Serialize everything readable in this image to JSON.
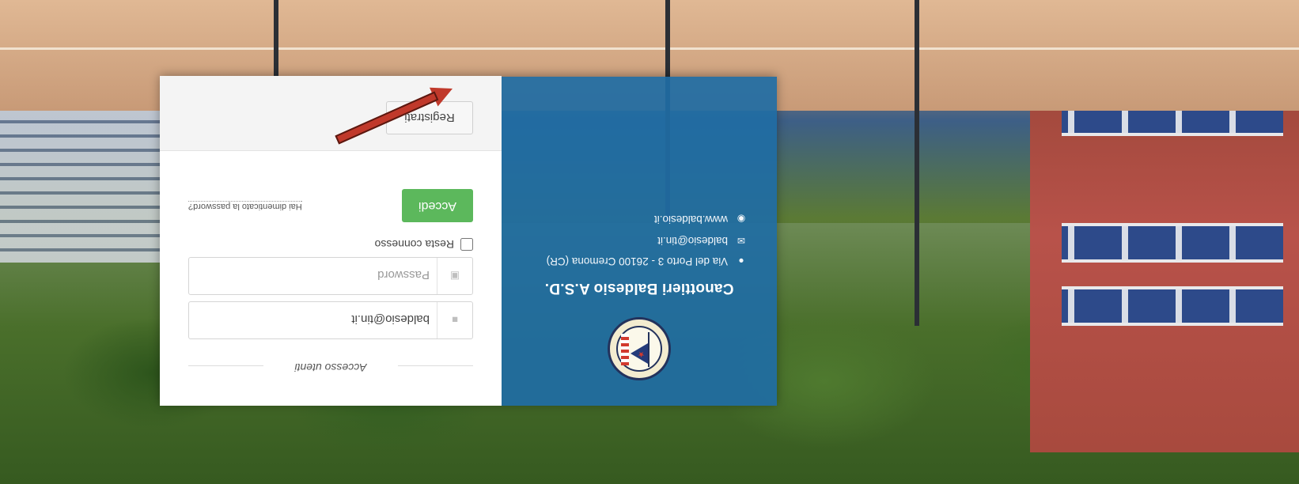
{
  "club": {
    "name": "Canottieri Baldesio A.S.D.",
    "logo_text": "CANOTTIERI BALDESIO 1887"
  },
  "contacts": [
    {
      "icon": "map-marker-icon",
      "text": "Via del Porto 3 - 26100 Cremona (CR)"
    },
    {
      "icon": "envelope-icon",
      "text": "baldesio@tin.it"
    },
    {
      "icon": "globe-icon",
      "text": "www.baldesio.it"
    }
  ],
  "login": {
    "section_title": "Accesso utenti",
    "username_value": "baldesio@tin.it",
    "password_placeholder": "Password",
    "remember_label": "Resta connesso",
    "login_button": "Accedi",
    "forgot_link": "Hai dimenticato la password?",
    "register_button": "Registrati"
  },
  "colors": {
    "info_panel": "#1f6da4",
    "login_button": "#5cb85c",
    "annotation_arrow": "#c0392b"
  }
}
